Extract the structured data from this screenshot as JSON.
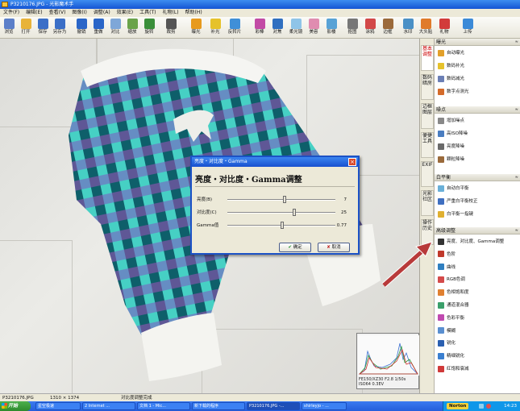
{
  "window": {
    "title": "P3210176.JPG - 光影魔术手"
  },
  "menu": [
    "文件(F)",
    "编辑(E)",
    "查看(V)",
    "图像(I)",
    "调整(A)",
    "效果(E)",
    "工具(T)",
    "礼物(L)",
    "帮助(H)"
  ],
  "toolbar": [
    {
      "label": "浏览",
      "icon": "browse-icon",
      "color": "#5b7fc9"
    },
    {
      "label": "打开",
      "icon": "open-icon",
      "color": "#e8b339"
    },
    {
      "label": "保存",
      "icon": "save-icon",
      "color": "#3b6fc7"
    },
    {
      "label": "另存为",
      "icon": "save-as-icon",
      "color": "#3b6fc7"
    },
    {
      "label": "撤销",
      "icon": "undo-icon",
      "color": "#2a66c8"
    },
    {
      "label": "重做",
      "icon": "redo-icon",
      "color": "#2a66c8"
    },
    {
      "label": "对比",
      "icon": "compare-icon",
      "color": "#7ea7d8"
    },
    {
      "label": "缩放",
      "icon": "zoom-icon",
      "color": "#6aa34a"
    },
    {
      "label": "旋转",
      "icon": "rotate-icon",
      "color": "#3a8f3a"
    },
    {
      "label": "裁剪",
      "icon": "crop-icon",
      "color": "#555"
    },
    {
      "label": "曝光",
      "icon": "exposure-icon",
      "color": "#e79a1e"
    },
    {
      "label": "补光",
      "icon": "fill-light-icon",
      "color": "#e6c22b"
    },
    {
      "label": "反转片",
      "icon": "reversal-film-icon",
      "color": "#3f8fd8"
    },
    {
      "label": "彩棒",
      "icon": "color-bar-icon",
      "color": "#c24aa5"
    },
    {
      "label": "对焦",
      "icon": "focus-icon",
      "color": "#2f6fc0"
    },
    {
      "label": "柔光镜",
      "icon": "soft-lens-icon",
      "color": "#8fc4e8"
    },
    {
      "label": "美容",
      "icon": "beauty-icon",
      "color": "#e08cb0"
    },
    {
      "label": "影楼",
      "icon": "studio-icon",
      "color": "#58a2d6"
    },
    {
      "label": "抠图",
      "icon": "cutout-icon",
      "color": "#777"
    },
    {
      "label": "涂鸦",
      "icon": "doodle-icon",
      "color": "#d24848"
    },
    {
      "label": "边框",
      "icon": "frame-icon",
      "color": "#9b6a3b"
    },
    {
      "label": "水印",
      "icon": "watermark-icon",
      "color": "#4a90c6"
    },
    {
      "label": "大头贴",
      "icon": "sticker-icon",
      "color": "#e07b2a"
    },
    {
      "label": "礼物",
      "icon": "gift-icon",
      "color": "#d23b3b"
    },
    {
      "label": "上传",
      "icon": "upload-icon",
      "color": "#3b8ad8"
    }
  ],
  "side_tabs": [
    "基本调整",
    "数码暗房",
    "边框图层",
    "便捷工具",
    "EXIF",
    "光影社区",
    "操作历史"
  ],
  "panel": {
    "sections": [
      {
        "title": "曝光",
        "items": [
          {
            "label": "自动曝光",
            "color": "#e2a02a"
          },
          {
            "label": "数码补光",
            "color": "#e6c22b"
          },
          {
            "label": "数码减光",
            "color": "#6b7fb5"
          },
          {
            "label": "数字点测光",
            "color": "#d46b2a"
          }
        ]
      },
      {
        "title": "噪点",
        "items": [
          {
            "label": "增加噪点",
            "color": "#888"
          },
          {
            "label": "高ISO降噪",
            "color": "#4a7dc0"
          },
          {
            "label": "亮度降噪",
            "color": "#6a6a6a"
          },
          {
            "label": "颗粒降噪",
            "color": "#9a6a3b"
          }
        ]
      },
      {
        "title": "白平衡",
        "items": [
          {
            "label": "自动白平衡",
            "color": "#6ab0d8"
          },
          {
            "label": "严重白平衡校正",
            "color": "#3f6fc0"
          },
          {
            "label": "白平衡一指键",
            "color": "#e0b030"
          }
        ]
      },
      {
        "title": "高级调整",
        "items": [
          {
            "label": "亮度、对比度、Gamma调整",
            "color": "#333"
          },
          {
            "label": "色阶",
            "color": "#c0392b"
          },
          {
            "label": "曲线",
            "color": "#2f7fc0"
          },
          {
            "label": "RGB色调",
            "color": "#d44a4a"
          },
          {
            "label": "色相饱和度",
            "color": "#e08030"
          },
          {
            "label": "通道混合器",
            "color": "#3a9f6a"
          },
          {
            "label": "色彩平衡",
            "color": "#c04ab0"
          },
          {
            "label": "模糊",
            "color": "#5a8fd0"
          },
          {
            "label": "锐化",
            "color": "#2a5fb0"
          },
          {
            "label": "精细锐化",
            "color": "#3a7fd0"
          },
          {
            "label": "红饱和衰减",
            "color": "#d03a3a"
          }
        ]
      }
    ]
  },
  "dialog": {
    "title": "亮度・对比度・Gamma",
    "heading": "亮度・对比度・Gamma调整",
    "sliders": [
      {
        "label": "亮度(B)",
        "value": "7",
        "level": 0.53
      },
      {
        "label": "对比度(C)",
        "value": "25",
        "level": 0.62
      },
      {
        "label": "Gamma值",
        "value": "0.77",
        "level": 0.51
      }
    ],
    "ok": "确定",
    "cancel": "取消"
  },
  "histogram": {
    "caption": "FE150/XZ30 F2.8 1/50s ISO64 0.3EV"
  },
  "status": {
    "filename": "P3210176.JPG",
    "dimensions": "1310 × 1374",
    "message": "对比度调整完成"
  },
  "taskbar": {
    "start": "开始",
    "tasks": [
      "星空极速",
      "2 Internet ...",
      "文档 1 - Mic...",
      "新下载的程序",
      "P3210176.JPG -...",
      "shirleyjo - ..."
    ],
    "tray_app": "Norton",
    "clock": "14:23"
  }
}
